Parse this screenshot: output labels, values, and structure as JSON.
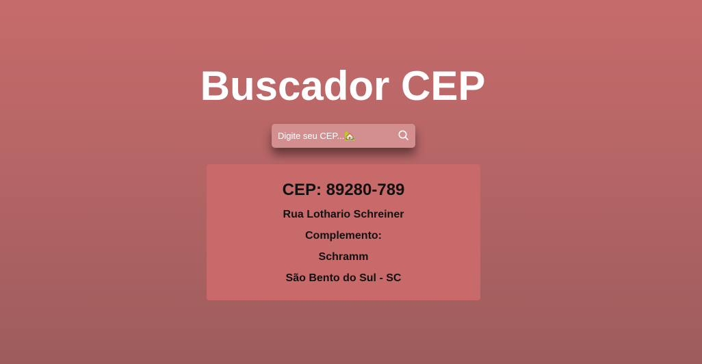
{
  "header": {
    "title": "Buscador CEP"
  },
  "search": {
    "placeholder": "Digite seu CEP...🏡",
    "value": "",
    "button_icon": "search-icon"
  },
  "result": {
    "cep_heading": "CEP: 89280-789",
    "street": "Rua Lothario Schreiner",
    "complement": "Complemento:",
    "neighborhood": "Schramm",
    "city_state": "São Bento do Sul - SC"
  },
  "colors": {
    "background_top": "#c56b6b",
    "background_bottom": "#9d5c5c",
    "card": "#c96a6a",
    "title_text": "#ffffff",
    "card_text": "#111111"
  }
}
